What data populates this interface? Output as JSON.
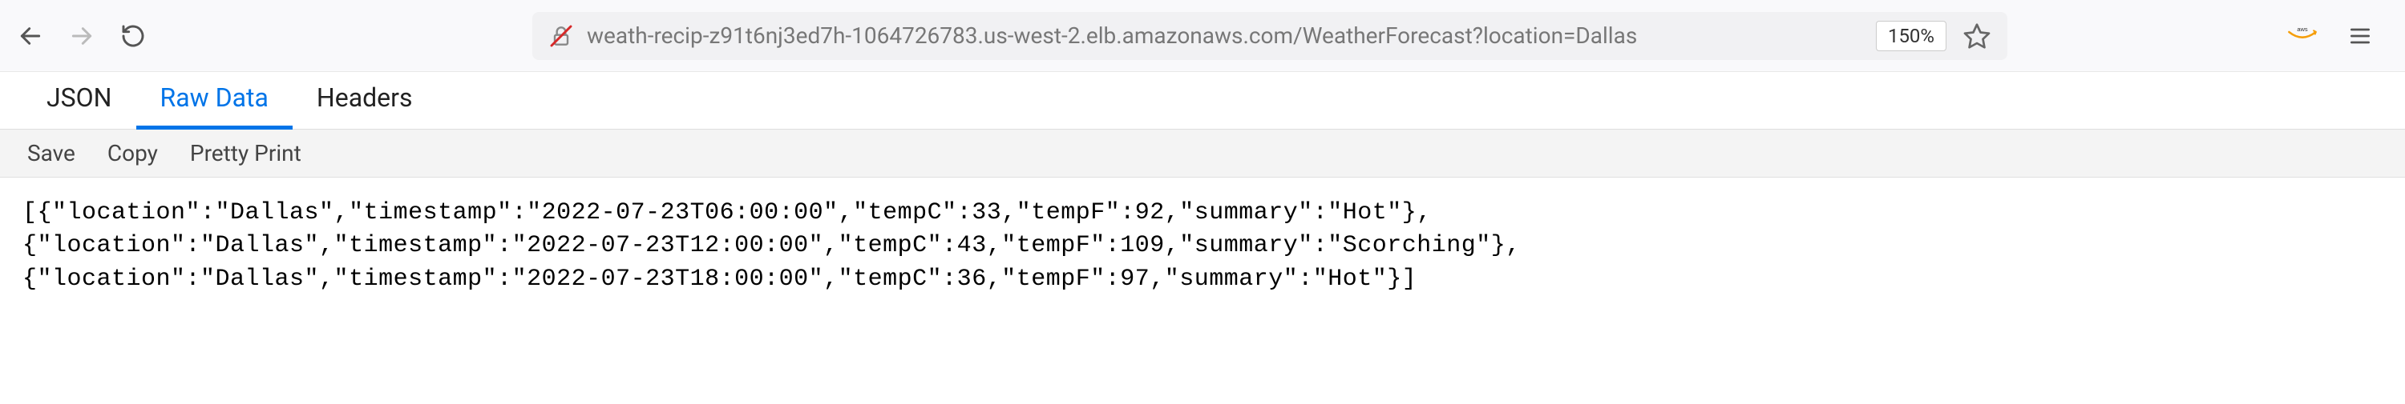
{
  "browser": {
    "url": "weath-recip-z91t6nj3ed7h-1064726783.us-west-2.elb.amazonaws.com/WeatherForecast?location=Dallas",
    "zoom": "150%"
  },
  "tabs": {
    "json": "JSON",
    "raw_data": "Raw Data",
    "headers": "Headers"
  },
  "actions": {
    "save": "Save",
    "copy": "Copy",
    "pretty_print": "Pretty Print"
  },
  "raw_json_display": "[{\"location\":\"Dallas\",\"timestamp\":\"2022-07-23T06:00:00\",\"tempC\":33,\"tempF\":92,\"summary\":\"Hot\"},\n{\"location\":\"Dallas\",\"timestamp\":\"2022-07-23T12:00:00\",\"tempC\":43,\"tempF\":109,\"summary\":\"Scorching\"},\n{\"location\":\"Dallas\",\"timestamp\":\"2022-07-23T18:00:00\",\"tempC\":36,\"tempF\":97,\"summary\":\"Hot\"}]",
  "response_data": [
    {
      "location": "Dallas",
      "timestamp": "2022-07-23T06:00:00",
      "tempC": 33,
      "tempF": 92,
      "summary": "Hot"
    },
    {
      "location": "Dallas",
      "timestamp": "2022-07-23T12:00:00",
      "tempC": 43,
      "tempF": 109,
      "summary": "Scorching"
    },
    {
      "location": "Dallas",
      "timestamp": "2022-07-23T18:00:00",
      "tempC": 36,
      "tempF": 97,
      "summary": "Hot"
    }
  ]
}
